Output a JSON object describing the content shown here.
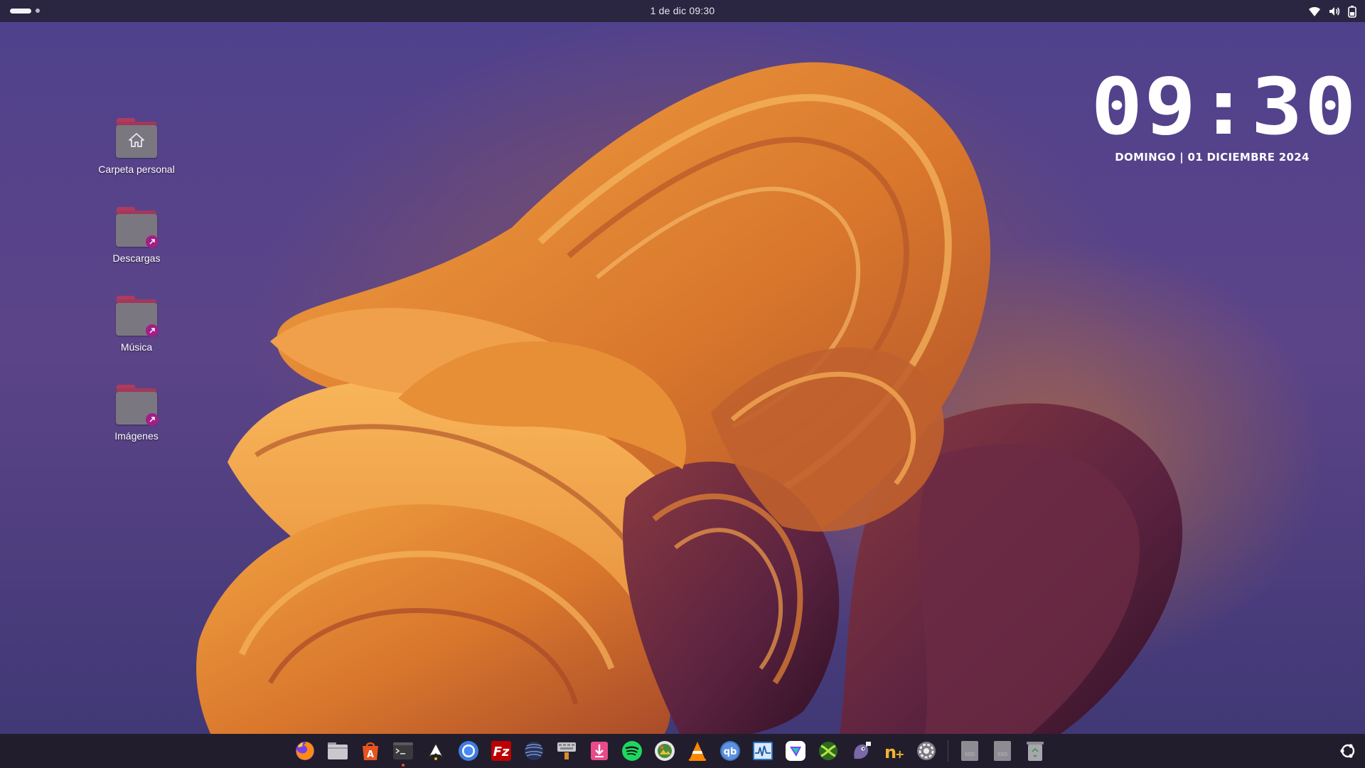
{
  "topbar": {
    "datetime": "1 de dic  09:30",
    "icons": [
      "workspace-indicator",
      "wifi-icon",
      "volume-icon",
      "battery-icon"
    ]
  },
  "desktop": {
    "icons": [
      {
        "label": "Carpeta personal",
        "icon": "home-folder-icon"
      },
      {
        "label": "Descargas",
        "icon": "folder-link-icon"
      },
      {
        "label": "Música",
        "icon": "folder-link-icon"
      },
      {
        "label": "Imágenes",
        "icon": "folder-link-icon"
      }
    ]
  },
  "clock_widget": {
    "time": "09:30",
    "date": "DOMINGO | 01 DICIEMBRE 2024"
  },
  "dock": {
    "apps": [
      {
        "name": "firefox-icon"
      },
      {
        "name": "files-icon"
      },
      {
        "name": "app-center-icon"
      },
      {
        "name": "terminal-icon",
        "running": true
      },
      {
        "name": "inkscape-icon"
      },
      {
        "name": "chromium-icon"
      },
      {
        "name": "filezilla-icon"
      },
      {
        "name": "globe-app-icon"
      },
      {
        "name": "keyboard-app-icon"
      },
      {
        "name": "download-app-icon"
      },
      {
        "name": "spotify-icon"
      },
      {
        "name": "photo-app-icon"
      },
      {
        "name": "vlc-icon"
      },
      {
        "name": "qbittorrent-icon"
      },
      {
        "name": "system-monitor-icon"
      },
      {
        "name": "proton-vpn-icon"
      },
      {
        "name": "xemu-icon"
      },
      {
        "name": "pidgin-icon"
      },
      {
        "name": "notepadqq-icon"
      },
      {
        "name": "settings-icon"
      }
    ],
    "drives": [
      {
        "name": "ssd-drive-icon",
        "label": "SSD"
      },
      {
        "name": "ssd-drive-icon",
        "label": "SSD"
      },
      {
        "name": "trash-icon"
      }
    ],
    "launcher": "ubuntu-logo-icon"
  },
  "colors": {
    "topbar_bg": "#2a2540",
    "dock_bg": "#221d2c",
    "folder_tab": "#b03a5e",
    "folder_body": "#7b7780",
    "emblem": "#a21f86",
    "wallpaper_orange": "#e8902f",
    "wallpaper_plum": "#5a2340"
  }
}
